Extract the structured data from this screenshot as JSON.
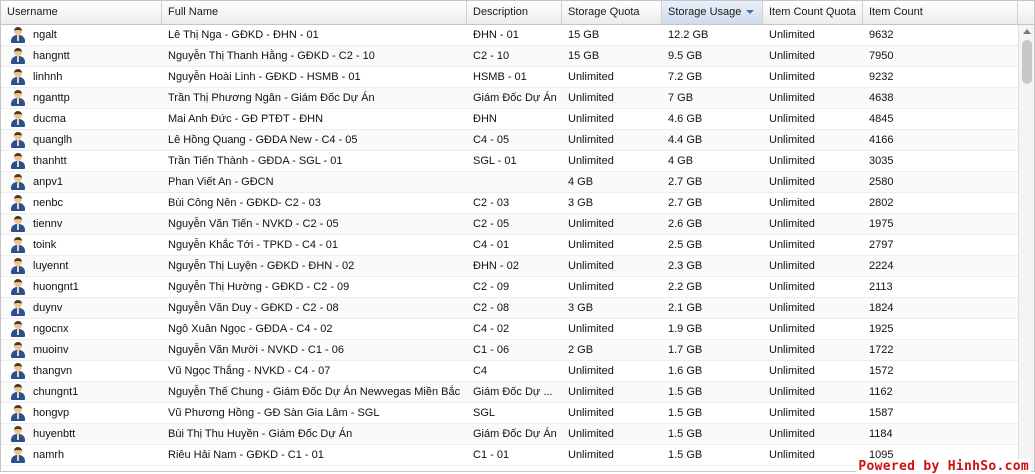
{
  "columns": [
    {
      "label": "Username"
    },
    {
      "label": "Full Name"
    },
    {
      "label": "Description"
    },
    {
      "label": "Storage Quota"
    },
    {
      "label": "Storage Usage"
    },
    {
      "label": "Item Count Quota"
    },
    {
      "label": "Item Count"
    }
  ],
  "sorted_column": "Storage Usage",
  "rows": [
    [
      "ngalt",
      "Lê Thị Nga - GĐKD - ĐHN - 01",
      "ĐHN - 01",
      "15 GB",
      "12.2 GB",
      "Unlimited",
      "9632"
    ],
    [
      "hangntt",
      "Nguyễn Thị Thanh Hằng - GĐKD - C2 - 10",
      "C2 - 10",
      "15 GB",
      "9.5 GB",
      "Unlimited",
      "7950"
    ],
    [
      "linhnh",
      "Nguyễn Hoài Linh - GĐKD - HSMB - 01",
      "HSMB - 01",
      "Unlimited",
      "7.2 GB",
      "Unlimited",
      "9232"
    ],
    [
      "nganttp",
      "Trần Thị Phương Ngân - Giám Đốc Dự Án",
      "Giám Đốc Dự Án",
      "Unlimited",
      "7 GB",
      "Unlimited",
      "4638"
    ],
    [
      "ducma",
      "Mai Anh Đức - GĐ PTĐT - ĐHN",
      "ĐHN",
      "Unlimited",
      "4.6 GB",
      "Unlimited",
      "4845"
    ],
    [
      "quanglh",
      "Lê Hồng Quang - GĐDA New - C4 - 05",
      "C4 - 05",
      "Unlimited",
      "4.4 GB",
      "Unlimited",
      "4166"
    ],
    [
      "thanhtt",
      "Trần Tiến Thành - GĐDA - SGL - 01",
      "SGL - 01",
      "Unlimited",
      "4 GB",
      "Unlimited",
      "3035"
    ],
    [
      "anpv1",
      "Phan Viết An - GĐCN",
      "",
      "4 GB",
      "2.7 GB",
      "Unlimited",
      "2580"
    ],
    [
      "nenbc",
      "Bùi Công Nên - GĐKD- C2 - 03",
      "C2 - 03",
      "3 GB",
      "2.7 GB",
      "Unlimited",
      "2802"
    ],
    [
      "tiennv",
      "Nguyễn Văn Tiến - NVKD - C2 - 05",
      "C2 - 05",
      "Unlimited",
      "2.6 GB",
      "Unlimited",
      "1975"
    ],
    [
      "toink",
      "Nguyễn Khắc Tới - TPKD - C4 - 01",
      "C4 - 01",
      "Unlimited",
      "2.5 GB",
      "Unlimited",
      "2797"
    ],
    [
      "luyennt",
      "Nguyễn Thị Luyện - GĐKD - ĐHN - 02",
      "ĐHN - 02",
      "Unlimited",
      "2.3 GB",
      "Unlimited",
      "2224"
    ],
    [
      "huongnt1",
      "Nguyễn Thị Hường - GĐKD - C2 - 09",
      "C2 - 09",
      "Unlimited",
      "2.2 GB",
      "Unlimited",
      "2113"
    ],
    [
      "duynv",
      "Nguyễn Văn Duy - GĐKD - C2 - 08",
      "C2 - 08",
      "3 GB",
      "2.1 GB",
      "Unlimited",
      "1824"
    ],
    [
      "ngocnx",
      "Ngô Xuân Ngọc - GĐDA - C4 - 02",
      "C4 - 02",
      "Unlimited",
      "1.9 GB",
      "Unlimited",
      "1925"
    ],
    [
      "muoinv",
      "Nguyễn Văn Mười - NVKD - C1 - 06",
      "C1 - 06",
      "2 GB",
      "1.7 GB",
      "Unlimited",
      "1722"
    ],
    [
      "thangvn",
      "Vũ Ngọc Thắng - NVKD - C4 - 07",
      "C4",
      "Unlimited",
      "1.6 GB",
      "Unlimited",
      "1572"
    ],
    [
      "chungnt1",
      "Nguyễn Thế Chung - Giám Đốc Dự Án Newvegas Miền Bắc",
      "Giám Đốc Dự ...",
      "Unlimited",
      "1.5 GB",
      "Unlimited",
      "1162"
    ],
    [
      "hongvp",
      "Vũ Phương Hồng - GĐ Sàn Gia Lâm - SGL",
      "SGL",
      "Unlimited",
      "1.5 GB",
      "Unlimited",
      "1587"
    ],
    [
      "huyenbtt",
      "Bùi Thị Thu Huyền - Giám Đốc Dự Án",
      "Giám Đốc Dự Án",
      "Unlimited",
      "1.5 GB",
      "Unlimited",
      "1184"
    ],
    [
      "namrh",
      "Riêu Hải Nam - GĐKD - C1 - 01",
      "C1 - 01",
      "Unlimited",
      "1.5 GB",
      "Unlimited",
      "1095"
    ]
  ],
  "watermark": "Powered by HinhSo.com"
}
